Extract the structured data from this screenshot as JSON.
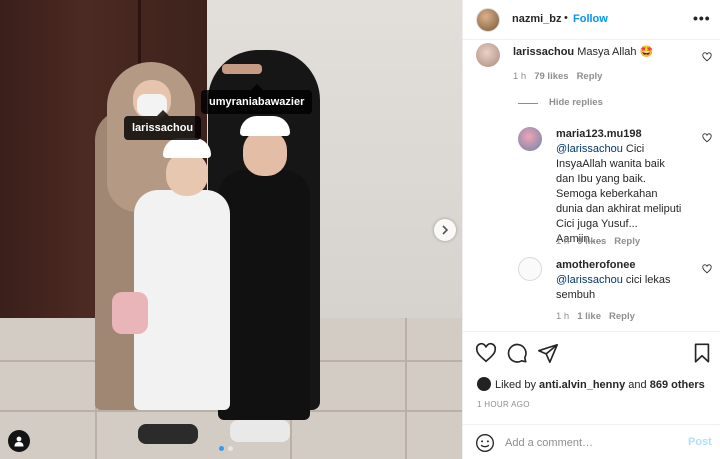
{
  "photo": {
    "tags": [
      {
        "username": "umyraniabawazier"
      },
      {
        "username": "larissachou"
      }
    ],
    "carousel": {
      "dots": 2,
      "active": 0
    }
  },
  "post_header": {
    "username": "nazmi_bz",
    "separator": "•",
    "follow_label": "Follow",
    "more_label": "•••"
  },
  "comments": [
    {
      "username": "larissachou",
      "text": "Masya Allah 🤩",
      "time": "1 h",
      "likes": "79 likes",
      "reply_label": "Reply"
    },
    {
      "hide_replies_label": "Hide replies"
    },
    {
      "username": "maria123.mu198",
      "mention": "@larissachou",
      "text": " Cici InsyaAllah wanita baik dan Ibu yang baik. Semoga keberkahan dunia dan akhirat meliputi Cici juga Yusuf... Aamiin....",
      "time": "1 h",
      "likes": "9 likes",
      "reply_label": "Reply"
    },
    {
      "username": "amotherofonee",
      "mention": "@larissachou",
      "text": " cici lekas sembuh",
      "time": "1 h",
      "likes": "1 like",
      "reply_label": "Reply"
    }
  ],
  "likes": {
    "prefix": "Liked by ",
    "first_user": "anti.alvin_henny",
    "middle": " and ",
    "others": "869 others"
  },
  "time_ago": "1 HOUR AGO",
  "add_comment": {
    "placeholder": "Add a comment…",
    "post_label": "Post"
  },
  "colors": {
    "link_blue": "#0095f6",
    "mention_blue": "#00376b",
    "muted": "#8e8e8e",
    "post_disabled": "#b2dffc"
  }
}
